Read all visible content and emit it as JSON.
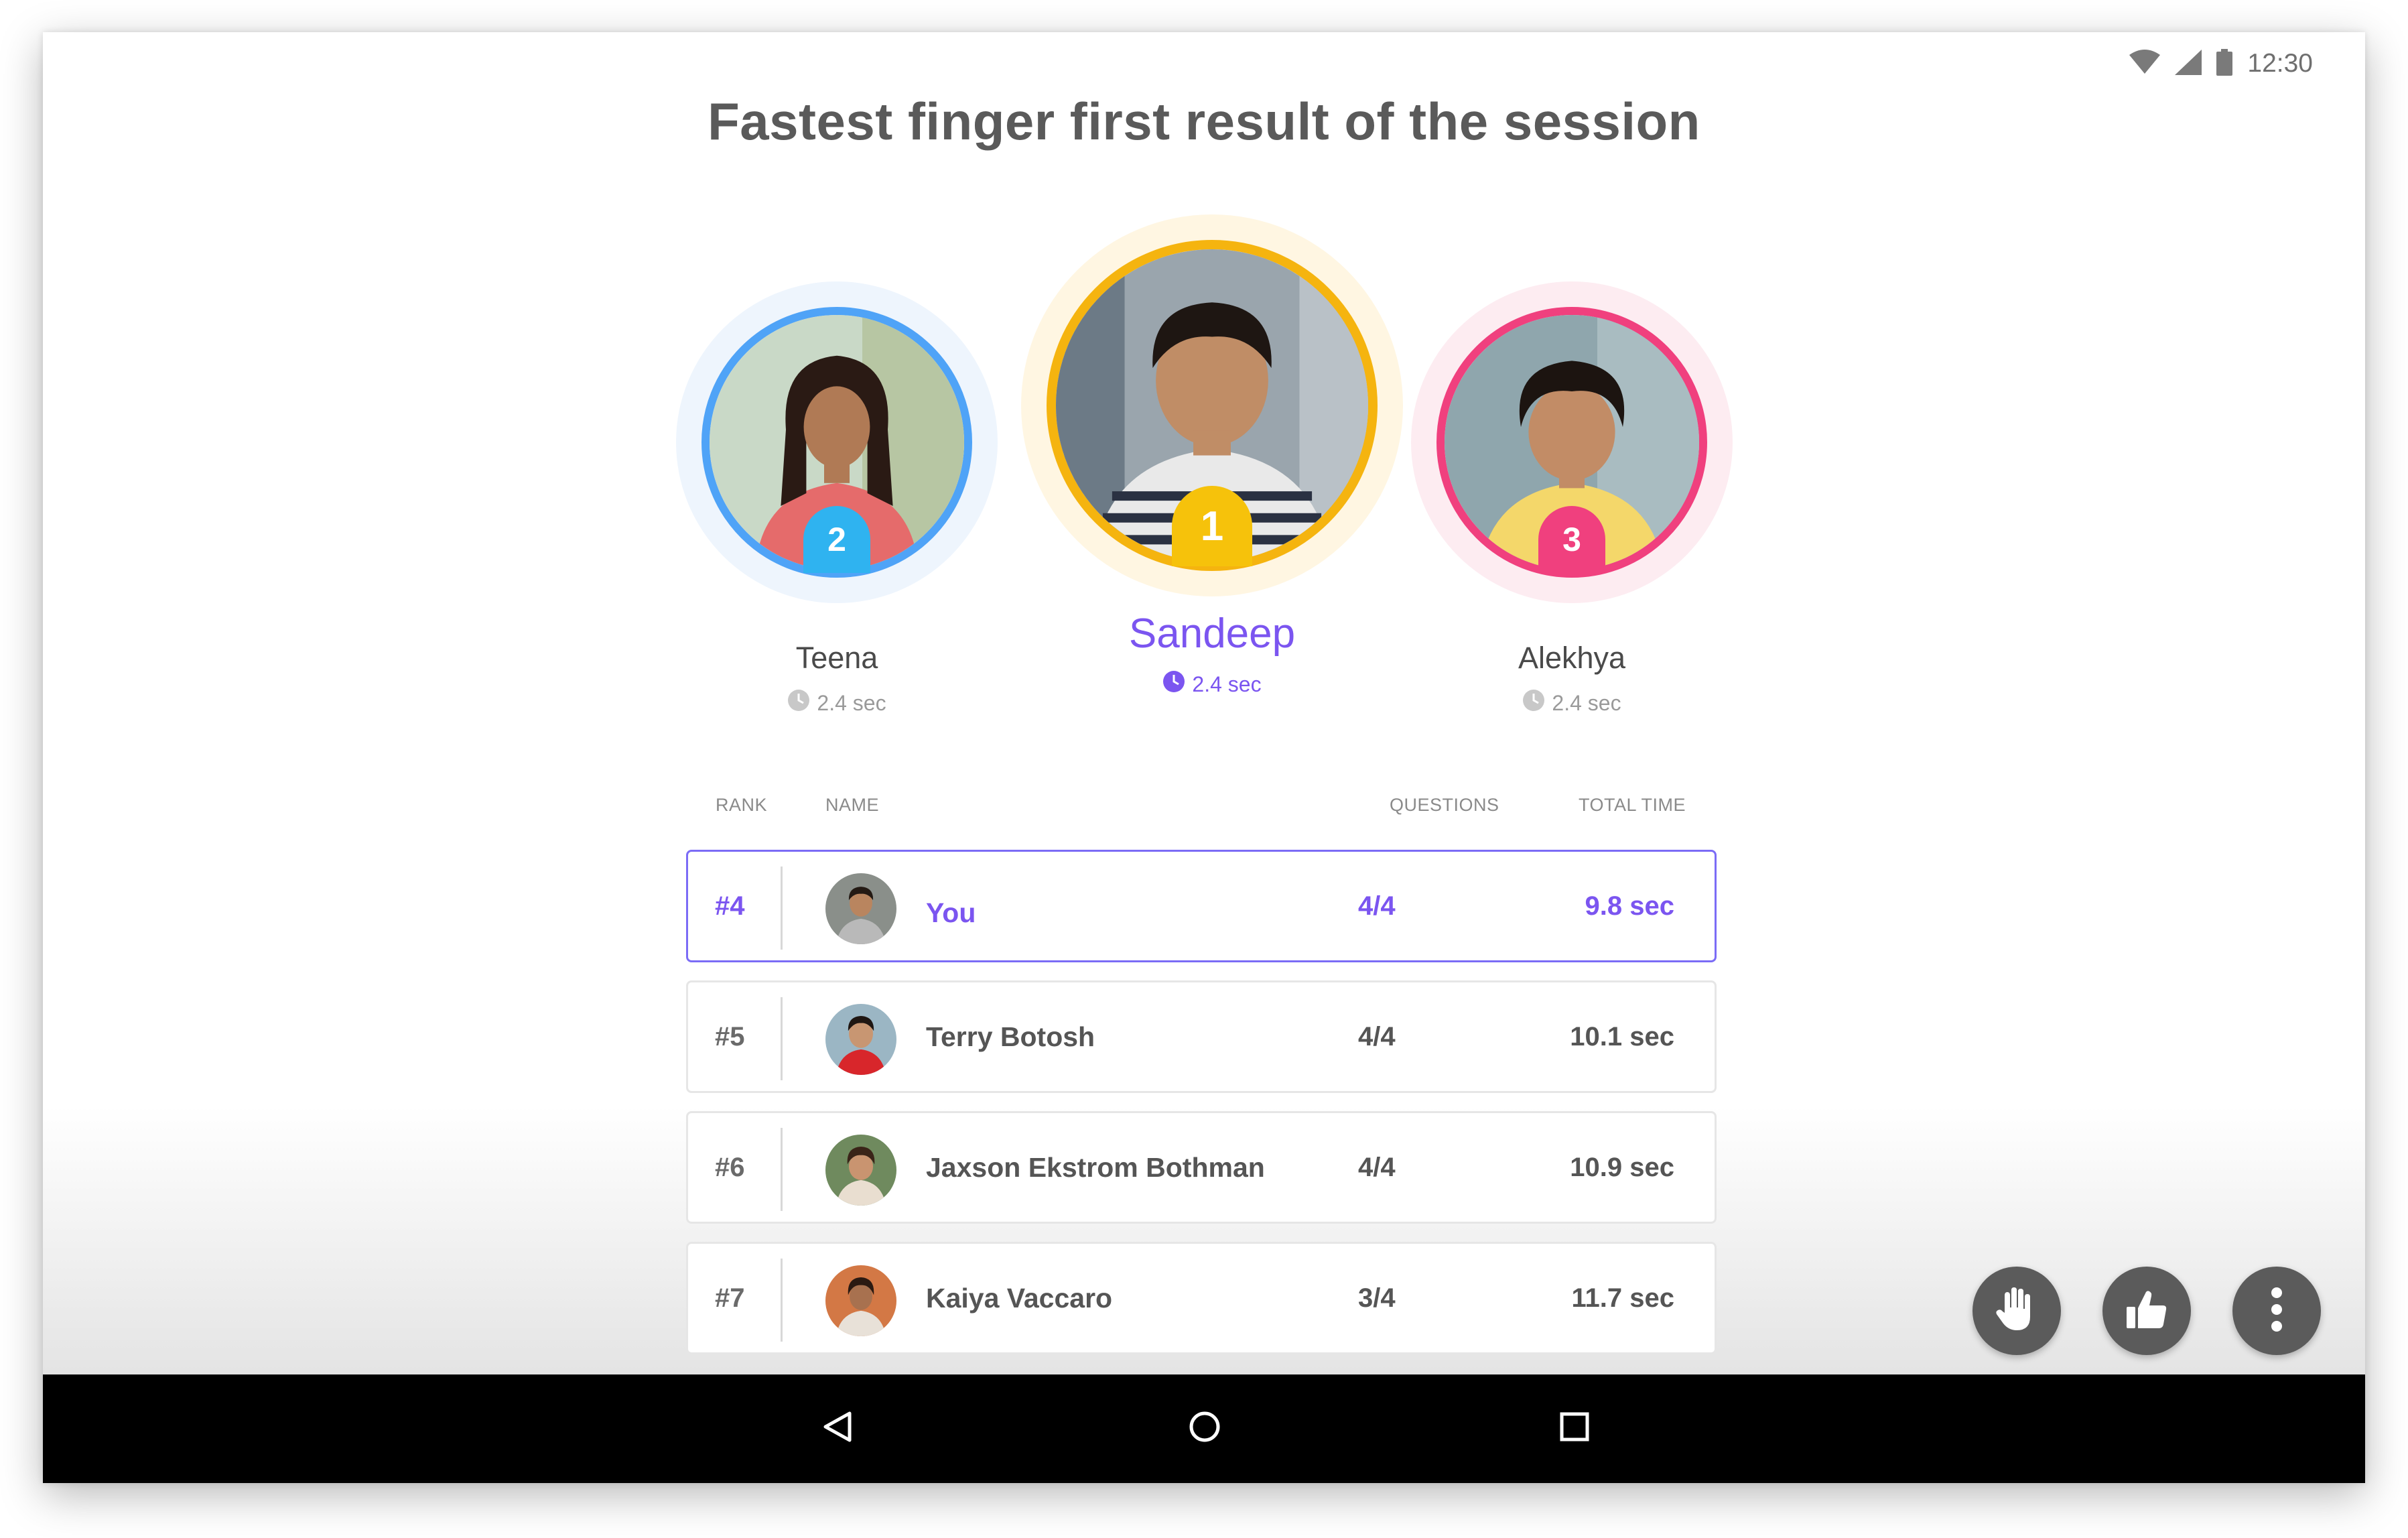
{
  "status_bar": {
    "time": "12:30",
    "icons": [
      "wifi-icon",
      "signal-icon",
      "battery-icon"
    ]
  },
  "title": "Fastest finger first result of the session",
  "podium": [
    {
      "rank": "2",
      "name": "Teena",
      "time": "2.4 sec",
      "ring_color": "#4fa3f7",
      "badge_color": "#2fb3f0"
    },
    {
      "rank": "1",
      "name": "Sandeep",
      "time": "2.4 sec",
      "ring_color": "#f5b40f",
      "badge_color": "#f6c20b"
    },
    {
      "rank": "3",
      "name": "Alekhya",
      "time": "2.4 sec",
      "ring_color": "#f0407e",
      "badge_color": "#f0407e"
    }
  ],
  "table": {
    "headers": {
      "rank": "RANK",
      "name": "NAME",
      "questions": "QUESTIONS",
      "total_time": "TOTAL TIME"
    },
    "rows": [
      {
        "rank": "#4",
        "name": "You",
        "questions": "4/4",
        "time": "9.8 sec",
        "highlight": true
      },
      {
        "rank": "#5",
        "name": "Terry Botosh",
        "questions": "4/4",
        "time": "10.1 sec",
        "highlight": false
      },
      {
        "rank": "#6",
        "name": "Jaxson Ekstrom Bothman",
        "questions": "4/4",
        "time": "10.9 sec",
        "highlight": false
      },
      {
        "rank": "#7",
        "name": "Kaiya Vaccaro",
        "questions": "3/4",
        "time": "11.7 sec",
        "highlight": false
      }
    ]
  },
  "fabs": [
    "hand-raise-icon",
    "thumbs-up-icon",
    "more-vert-icon"
  ],
  "nav": [
    "back-icon",
    "home-icon",
    "recents-icon"
  ],
  "colors": {
    "accent": "#7b55f0",
    "highlight_border": "#7b6cf6",
    "fab_bg": "#5b5b5b"
  }
}
